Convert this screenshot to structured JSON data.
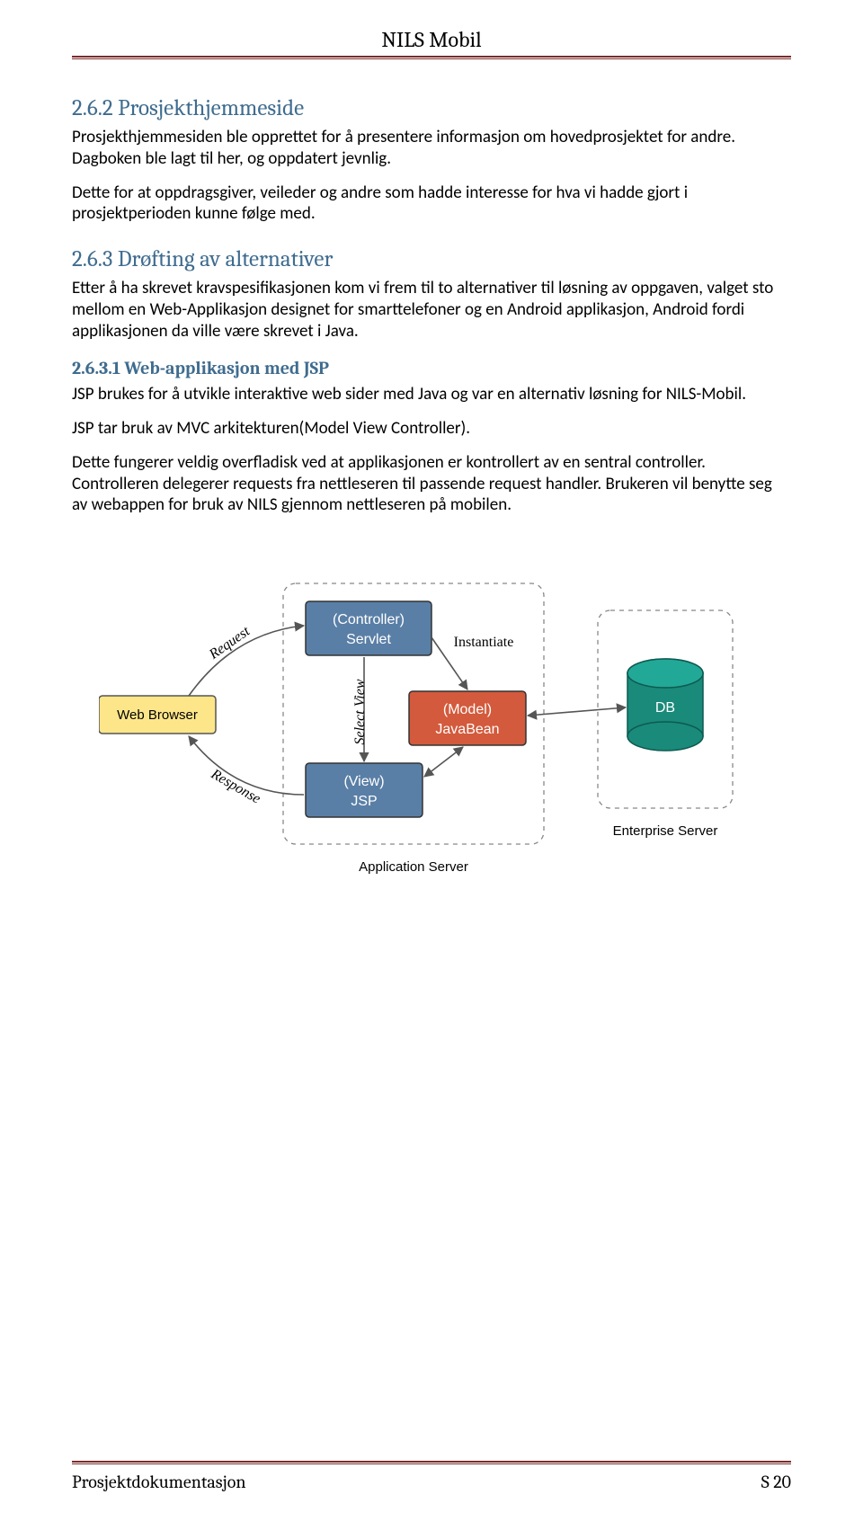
{
  "header": {
    "title": "NILS Mobil"
  },
  "sections": {
    "s262": {
      "heading": "2.6.2 Prosjekthjemmeside",
      "p1": "Prosjekthjemmesiden ble opprettet for å presentere informasjon om hovedprosjektet for andre. Dagboken ble lagt til her, og oppdatert jevnlig.",
      "p2": "Dette for at oppdragsgiver, veileder og andre som hadde interesse for hva vi hadde gjort i prosjektperioden kunne følge med."
    },
    "s263": {
      "heading": "2.6.3 Drøfting av alternativer",
      "p1": "Etter å ha skrevet kravspesifikasjonen kom vi frem til to alternativer til løsning av oppgaven, valget sto mellom en Web-Applikasjon designet for smarttelefoner og en Android applikasjon, Android fordi applikasjonen da ville være skrevet i Java."
    },
    "s2631": {
      "heading": "2.6.3.1  Web-applikasjon med JSP",
      "p1": "JSP brukes for å utvikle interaktive web sider med Java og var en alternativ løsning for NILS-Mobil.",
      "p2": "JSP tar bruk av MVC arkitekturen(Model View Controller).",
      "p3": "Dette fungerer veldig overfladisk ved at applikasjonen er kontrollert av en sentral controller. Controlleren delegerer requests fra nettleseren til passende request handler. Brukeren vil benytte seg av webappen for bruk av NILS gjennom nettleseren på mobilen."
    }
  },
  "diagram": {
    "web_browser": "Web Browser",
    "controller_l1": "(Controller)",
    "controller_l2": "Servlet",
    "model_l1": "(Model)",
    "model_l2": "JavaBean",
    "view_l1": "(View)",
    "view_l2": "JSP",
    "db": "DB",
    "request": "Request",
    "response": "Response",
    "instantiate": "Instantiate",
    "select_view": "Select View",
    "app_server": "Application Server",
    "ent_server": "Enterprise Server"
  },
  "footer": {
    "left": "Prosjektdokumentasjon",
    "right": "S 20"
  }
}
